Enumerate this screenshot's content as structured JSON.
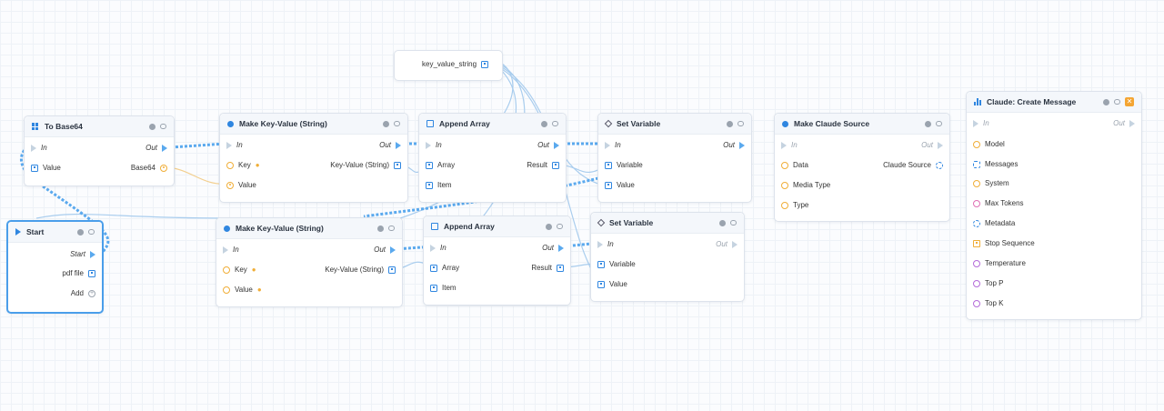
{
  "nodes": {
    "key_value_string": {
      "label": "key_value_string"
    },
    "to_base64": {
      "title": "To Base64",
      "in": "In",
      "out": "Out",
      "value": "Value",
      "output": "Base64"
    },
    "start": {
      "title": "Start",
      "start": "Start",
      "pdf_file": "pdf file",
      "add": "Add"
    },
    "make_kv_1": {
      "title": "Make Key-Value (String)",
      "in": "In",
      "out": "Out",
      "key": "Key",
      "value": "Value",
      "output": "Key-Value (String)"
    },
    "append_1": {
      "title": "Append Array",
      "in": "In",
      "out": "Out",
      "array": "Array",
      "item": "Item",
      "result": "Result"
    },
    "set_var_1": {
      "title": "Set Variable",
      "in": "In",
      "out": "Out",
      "variable": "Variable",
      "value": "Value"
    },
    "make_claude_source": {
      "title": "Make Claude Source",
      "in": "In",
      "out": "Out",
      "data": "Data",
      "media_type": "Media Type",
      "type": "Type",
      "output": "Claude Source"
    },
    "make_kv_2": {
      "title": "Make Key-Value (String)",
      "in": "In",
      "out": "Out",
      "key": "Key",
      "value": "Value",
      "output": "Key-Value (String)"
    },
    "append_2": {
      "title": "Append Array",
      "in": "In",
      "out": "Out",
      "array": "Array",
      "item": "Item",
      "result": "Result"
    },
    "set_var_2": {
      "title": "Set Variable",
      "in": "In",
      "out": "Out",
      "variable": "Variable",
      "value": "Value"
    },
    "claude_create_message": {
      "title": "Claude: Create Message",
      "in": "In",
      "out": "Out",
      "params": [
        "Model",
        "Messages",
        "System",
        "Max Tokens",
        "Metadata",
        "Stop Sequence",
        "Temperature",
        "Top P",
        "Top K"
      ]
    }
  },
  "colors": {
    "accent": "#2f86e0",
    "wire": "#5aa9ee",
    "warning": "#f4a532",
    "selected": "#4a9eea"
  }
}
